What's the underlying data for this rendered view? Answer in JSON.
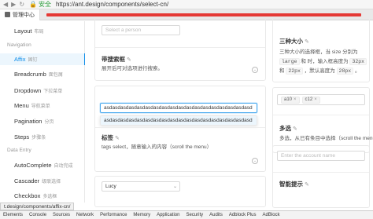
{
  "browser": {
    "back": "◀",
    "forward": "▶",
    "reload": "↻",
    "secure_label": "安全",
    "url": "https://ant.design/components/select-cn/",
    "tab_title": "管理中心"
  },
  "sidebar": {
    "items": [
      {
        "label": "Layout",
        "cn": "布局"
      },
      {
        "label": "Affix",
        "cn": "固钉"
      },
      {
        "label": "Breadcrumb",
        "cn": "面包屑"
      },
      {
        "label": "Dropdown",
        "cn": "下拉菜单"
      },
      {
        "label": "Menu",
        "cn": "导航菜单"
      },
      {
        "label": "Pagination",
        "cn": "分页"
      },
      {
        "label": "Steps",
        "cn": "步骤条"
      },
      {
        "label": "AutoComplete",
        "cn": "自动完成"
      },
      {
        "label": "Cascader",
        "cn": "级联选择"
      },
      {
        "label": "Checkbox",
        "cn": "多选框"
      }
    ],
    "groups": [
      "Navigation",
      "Data Entry"
    ]
  },
  "center": {
    "person_placeholder": "Select a person",
    "search_title": "带搜索框",
    "search_desc": "展开后可对选项进行搜索。",
    "long_value": "asdasdasdasdasdasdasdasdasdasdasdasdasdasdasdasdasdasd",
    "dropdown_option": "asdasdasdasdasdasdasdasdasdasdasdasdasdasdasdasdasdasd",
    "tags_title": "标签",
    "tags_desc": "tags select，随意输入的内容（scroll the menu）",
    "lucy": "Lucy"
  },
  "right": {
    "size_title": "三种大小",
    "size_desc_1": "三种大小的选择框，当 size 分别为",
    "size_large": "large",
    "size_and": "和",
    "size_desc_2": "时，输入框高度为",
    "size_32": "32px",
    "size_and2": "和",
    "size_22": "22px",
    "size_desc_3": "，默认高度为",
    "size_28": "28px",
    "size_end": "。",
    "tags": [
      "a10",
      "c12"
    ],
    "multi_title": "多选",
    "multi_desc": "多选，从已有条目中选择（scroll the menu）",
    "account_placeholder": "Enter the account name",
    "smart_title": "智能提示"
  },
  "status_url": "t.design/components/affix-cn/",
  "devtools": [
    "Elements",
    "Console",
    "Sources",
    "Network",
    "Performance",
    "Memory",
    "Application",
    "Security",
    "Audits",
    "Adblock Plus",
    "AdBlock"
  ]
}
